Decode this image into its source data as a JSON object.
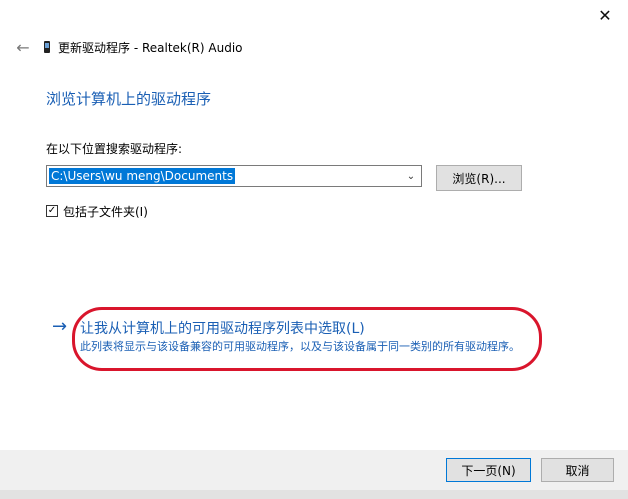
{
  "window": {
    "close_glyph": "✕",
    "title": "更新驱动程序 - Realtek(R) Audio",
    "back_glyph": "←"
  },
  "content": {
    "page_title": "浏览计算机上的驱动程序",
    "search_label": "在以下位置搜索驱动程序:",
    "path_value": "C:\\Users\\wu meng\\Documents",
    "combo_arrow_glyph": "⌄",
    "browse_label": "浏览(R)...",
    "include_subfolders": {
      "checked": true,
      "check_glyph": "✓",
      "label": "包括子文件夹(I)"
    },
    "pick_option": {
      "arrow_glyph": "→",
      "title": "让我从计算机上的可用驱动程序列表中选取(L)",
      "description": "此列表将显示与该设备兼容的可用驱动程序，以及与该设备属于同一类别的所有驱动程序。"
    }
  },
  "footer": {
    "next_label": "下一页(N)",
    "cancel_label": "取消"
  },
  "colors": {
    "link_blue": "#1a5fb4",
    "selection_blue": "#0078d7",
    "annotation_red": "#d9152c",
    "footer_bg": "#f0f0f0"
  }
}
